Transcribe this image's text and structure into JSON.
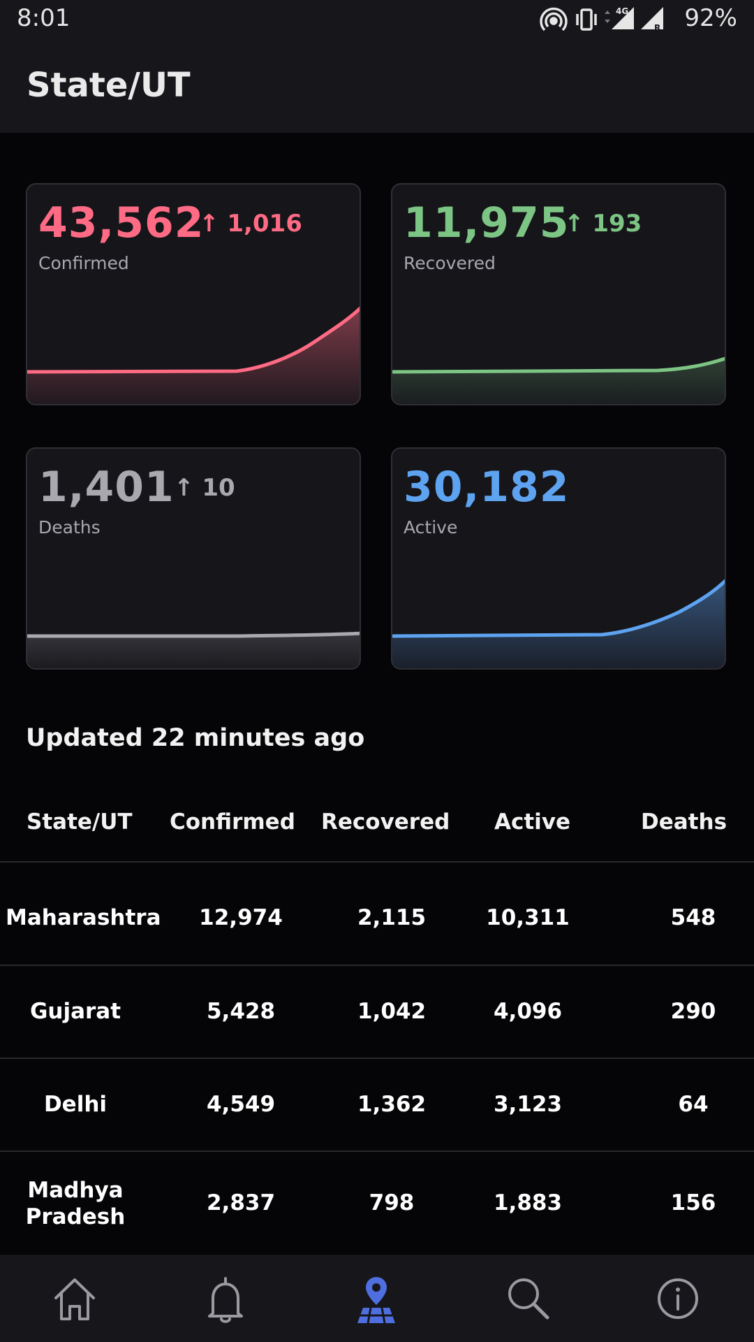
{
  "status_bar": {
    "time": "8:01",
    "battery": "92%",
    "icons": [
      "hotspot-icon",
      "vibrate-icon",
      "4g-signal-icon",
      "signal-roaming-icon"
    ]
  },
  "app_bar": {
    "title": "State/UT"
  },
  "cards": {
    "confirmed": {
      "value": "43,562",
      "delta": "↑ 1,016",
      "label": "Confirmed",
      "color": "#ff6b84"
    },
    "recovered": {
      "value": "11,975",
      "delta": "↑ 193",
      "label": "Recovered",
      "color": "#7dc584"
    },
    "deaths": {
      "value": "1,401",
      "delta": "↑ 10",
      "label": "Deaths",
      "color": "#a8a8ae"
    },
    "active": {
      "value": "30,182",
      "delta": "",
      "label": "Active",
      "color": "#5ea3f0"
    }
  },
  "updated_text": "Updated 22 minutes ago",
  "table": {
    "headers": [
      "State/UT",
      "Confirmed",
      "Recovered",
      "Active",
      "Deaths"
    ],
    "rows": [
      [
        "Maharashtra",
        "12,974",
        "2,115",
        "10,311",
        "548"
      ],
      [
        "Gujarat",
        "5,428",
        "1,042",
        "4,096",
        "290"
      ],
      [
        "Delhi",
        "4,549",
        "1,362",
        "3,123",
        "64"
      ],
      [
        "Madhya Pradesh",
        "2,837",
        "798",
        "1,883",
        "156"
      ]
    ]
  },
  "bottom_nav": {
    "items": [
      "home-icon",
      "bell-icon",
      "map-icon",
      "search-icon",
      "info-icon"
    ],
    "active": "map-icon",
    "active_color": "#4f6fe0"
  }
}
